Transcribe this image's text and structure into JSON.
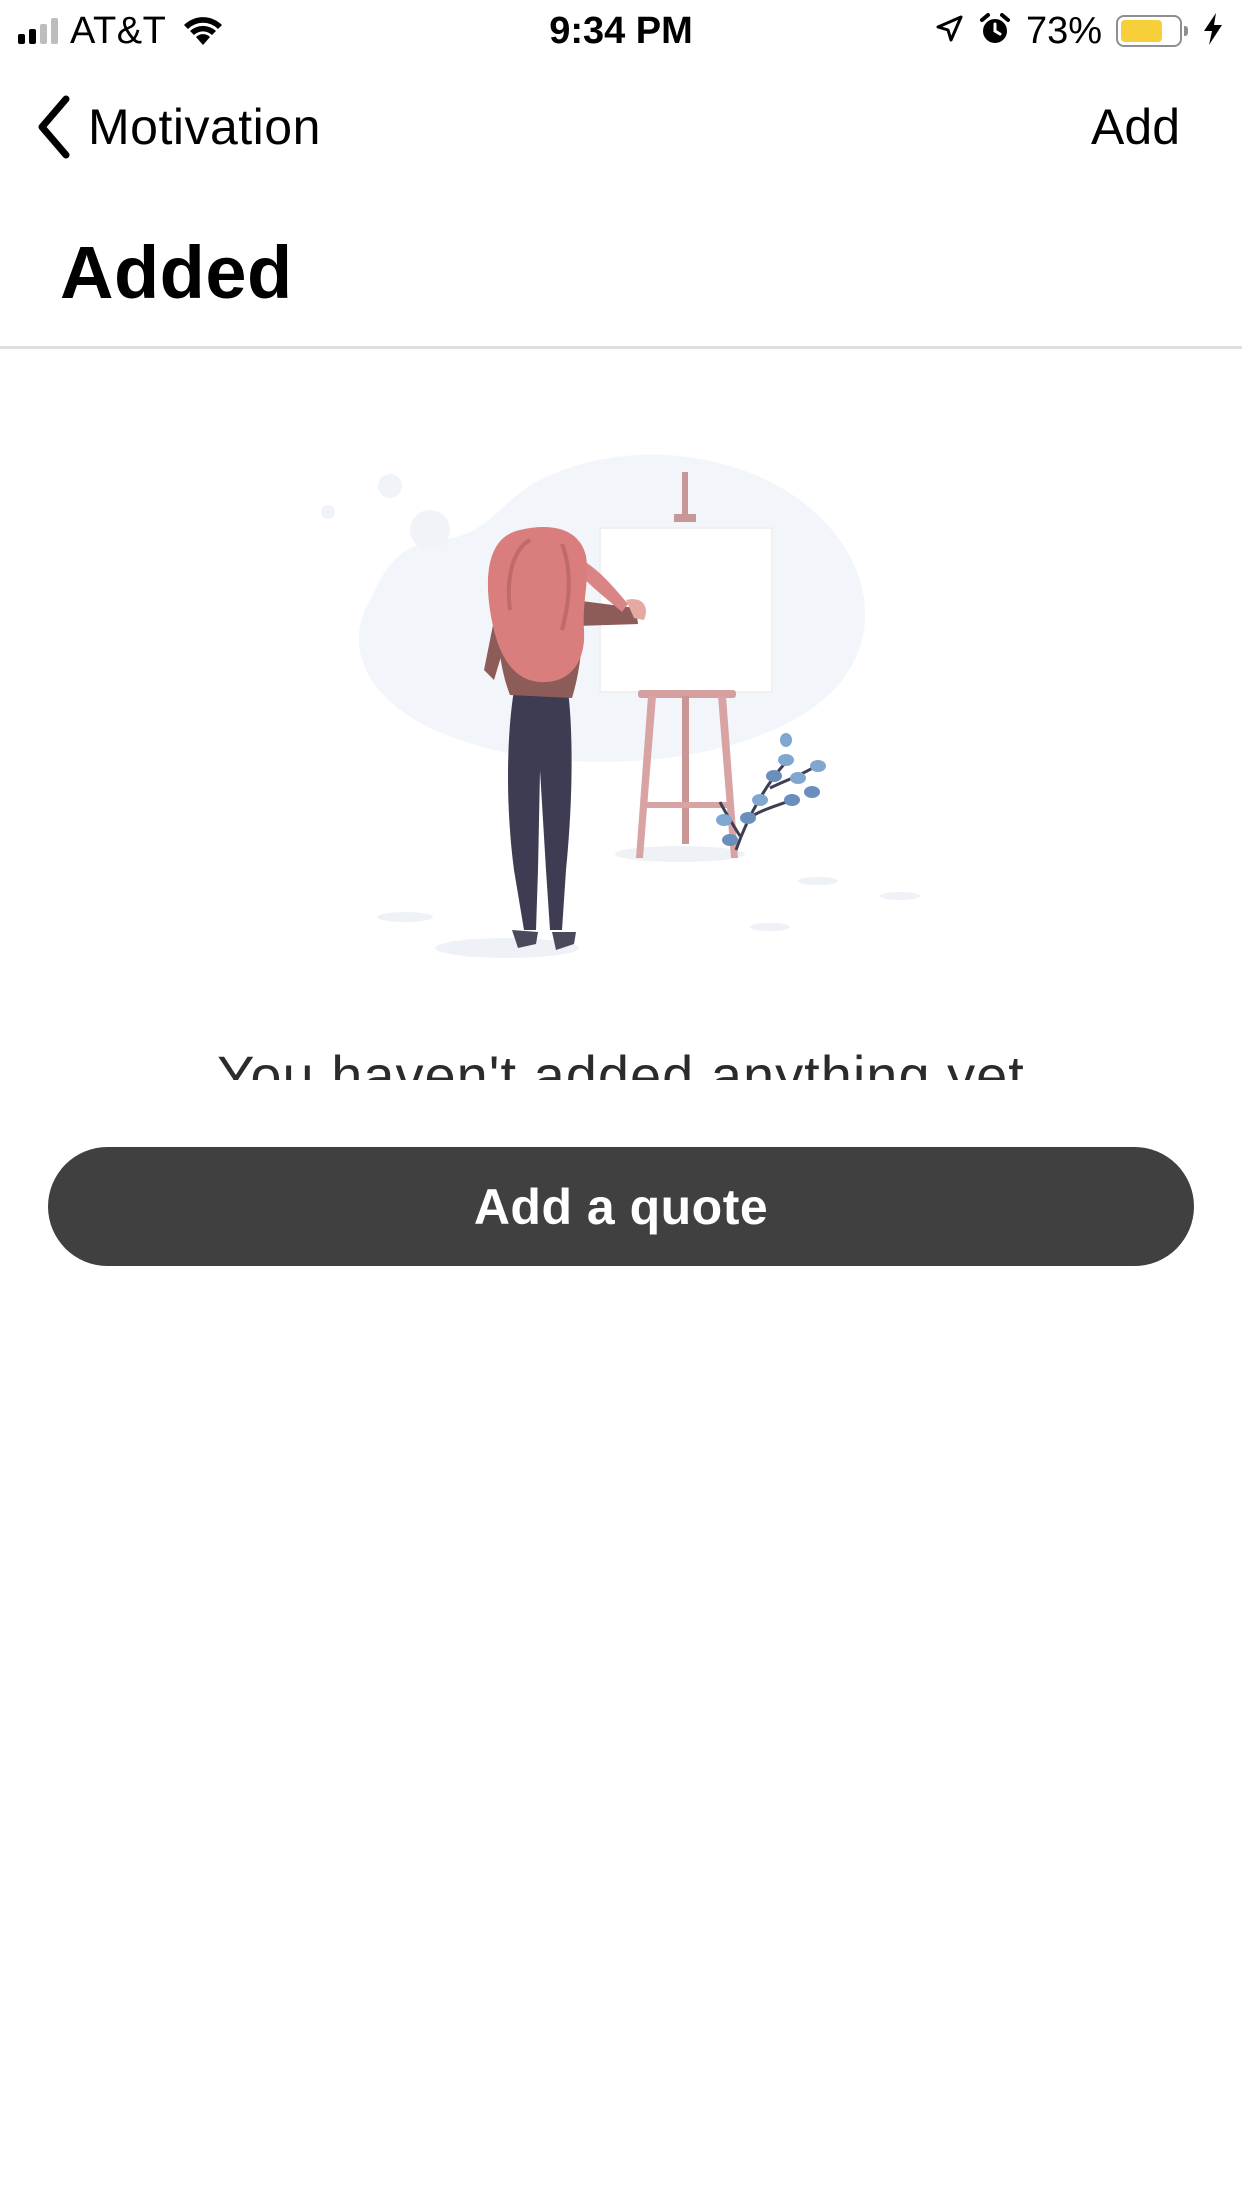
{
  "status_bar": {
    "carrier": "AT&T",
    "time": "9:34 PM",
    "battery_percent": "73%",
    "battery_level": 0.73,
    "icons": [
      "signal-icon",
      "wifi-icon",
      "location-arrow-icon",
      "alarm-icon",
      "battery-icon",
      "charging-bolt-icon"
    ]
  },
  "nav": {
    "back_label": "Motivation",
    "back_icon": "chevron-left-icon",
    "add_label": "Add"
  },
  "page": {
    "title": "Added"
  },
  "empty_state": {
    "illustration": "woman-painting-at-easel-illustration",
    "message": "You haven't added anything yet",
    "button_label": "Add a quote"
  },
  "colors": {
    "button_bg": "#404040",
    "battery_fill": "#f6cf3b",
    "divider": "#e0e0e0"
  }
}
